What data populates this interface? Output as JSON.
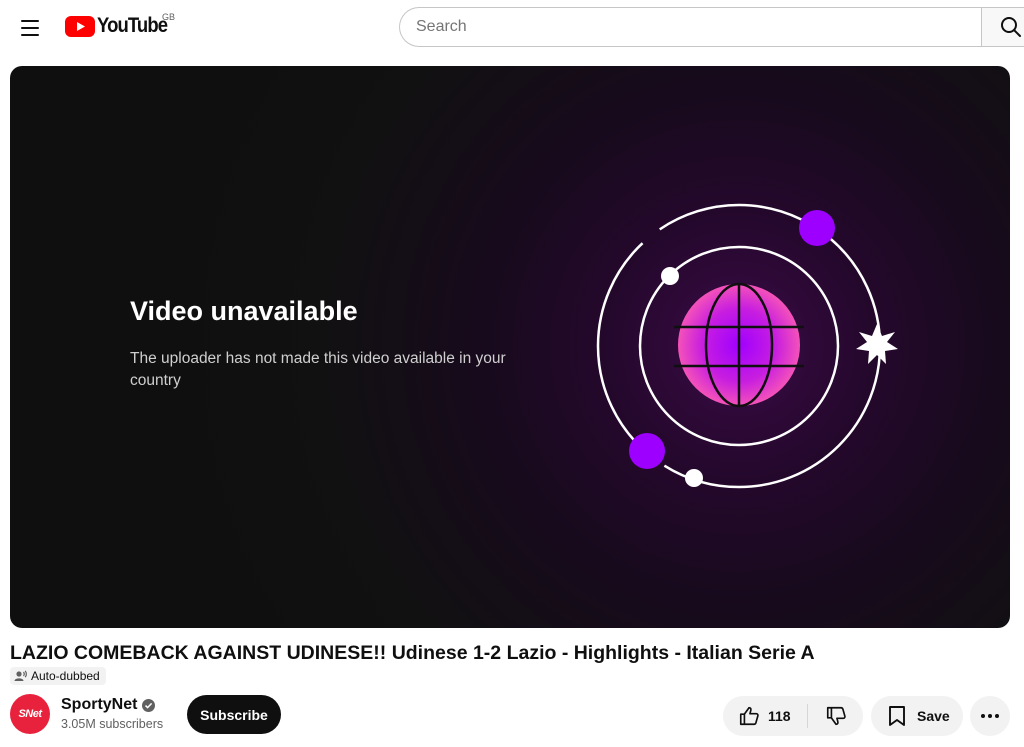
{
  "header": {
    "logo_text": "YouTube",
    "country_code": "GB",
    "search_placeholder": "Search",
    "menu_icon": "hamburger-menu-icon",
    "search_icon": "search-icon",
    "brand_color": "#ff0000"
  },
  "player": {
    "error_title": "Video unavailable",
    "error_message": "The uploader has not made this video available in your country",
    "accent_color": "#9d00ff"
  },
  "video": {
    "title": "LAZIO COMEBACK AGAINST UDINESE!! Udinese 1-2 Lazio - Highlights - Italian Serie A",
    "badge": "Auto-dubbed"
  },
  "channel": {
    "avatar_text": "SNet",
    "name": "SportyNet",
    "subscribers": "3.05M subscribers",
    "subscribe_label": "Subscribe",
    "avatar_color": "#e8223c"
  },
  "actions": {
    "like_count": "118",
    "save_label": "Save"
  }
}
